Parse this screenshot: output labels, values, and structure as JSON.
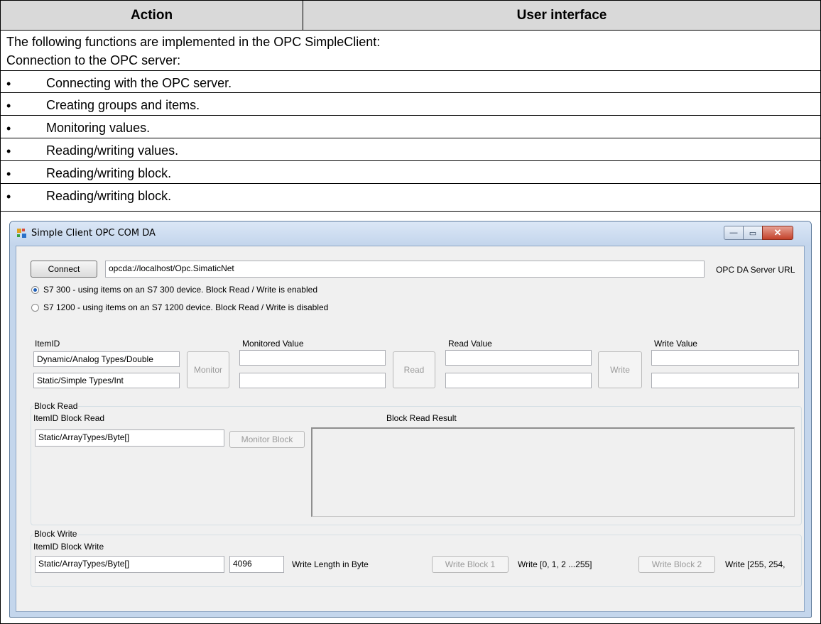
{
  "table": {
    "header_action": "Action",
    "header_ui": "User interface",
    "intro": "The following functions are implemented in the OPC SimpleClient:",
    "subheading": "Connection to the OPC server:",
    "bullets": [
      "Connecting with the OPC server.",
      "Creating groups and items.",
      "Monitoring values.",
      "Reading/writing values.",
      "Reading/writing block."
    ],
    "bullet_symbol": "•"
  },
  "window": {
    "title": "Simple Client OPC COM DA",
    "minimize_icon": "minimize-icon",
    "maximize_icon": "maximize-icon",
    "close_icon": "close-icon",
    "min_glyph": "—",
    "max_glyph": "▭",
    "close_glyph": "✕"
  },
  "connection": {
    "connect_label": "Connect",
    "url_value": "opcda://localhost/Opc.SimaticNet",
    "url_label": "OPC DA Server URL"
  },
  "device_options": [
    {
      "label": "S7 300 - using items on an S7 300 device. Block Read / Write is enabled",
      "selected": true
    },
    {
      "label": "S7 1200 - using items on an S7 1200 device. Block Read / Write is disabled",
      "selected": false
    }
  ],
  "items": {
    "col_itemid": "ItemID",
    "col_monitored": "Monitored Value",
    "col_read": "Read Value",
    "col_write": "Write Value",
    "item1": "Dynamic/Analog Types/Double",
    "item2": "Static/Simple Types/Int",
    "monitor_label": "Monitor",
    "read_label": "Read",
    "write_label": "Write"
  },
  "block_read": {
    "group_title": "Block Read",
    "itemid_label": "ItemID Block Read",
    "itemid_value": "Static/ArrayTypes/Byte[]",
    "monitor_block_label": "Monitor Block",
    "result_label": "Block Read Result"
  },
  "block_write": {
    "group_title": "Block Write",
    "itemid_label": "ItemID Block Write",
    "itemid_value": "Static/ArrayTypes/Byte[]",
    "length_value": "4096",
    "length_label": "Write Length in Byte",
    "write_block1_label": "Write Block 1",
    "write_block1_desc": "Write [0, 1, 2 ...255]",
    "write_block2_label": "Write Block 2",
    "write_block2_desc": "Write [255, 254,"
  }
}
